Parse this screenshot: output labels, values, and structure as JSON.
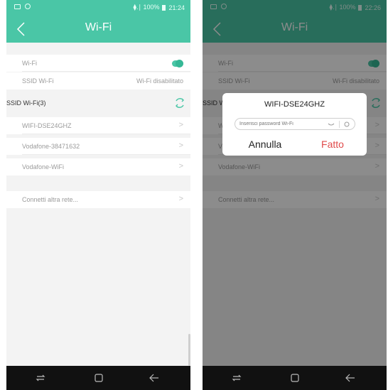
{
  "phones": [
    {
      "status_time": "21:24",
      "status_signal": "⧫.∣ 100%",
      "title": "Wi-Fi",
      "wifi_label": "Wi-Fi",
      "wifi_enabled": true,
      "ssid_label": "SSID Wi-Fi",
      "ssid_value": "Wi-Fi disabilitato",
      "networks_header": "SSID Wi-Fi(3)",
      "networks": [
        "WIFI-DSE24GHZ",
        "Vodafone-38471632",
        "Vodafone-WiFi"
      ],
      "other_network": "Connetti altra rete..."
    },
    {
      "status_time": "22:26",
      "status_signal": "⧫.∣ 100%",
      "title": "Wi-Fi",
      "wifi_label": "Wi-Fi",
      "wifi_enabled": true,
      "ssid_label": "SSID Wi-Fi",
      "ssid_value": "Wi-Fi disabilitato",
      "networks_header": "SSID W",
      "networks": [
        "WiF",
        "Voc",
        "Vodafone-WiFi"
      ],
      "other_network": "Connetti altra rete...",
      "dialog": {
        "title": "WIFI-DSE24GHZ",
        "password_placeholder": "Inserisci password Wi-Fi",
        "cancel_label": "Annulla",
        "done_label": "Fatto"
      }
    }
  ],
  "colors": {
    "accent": "#4ac6a6",
    "done": "#e04b4b",
    "navbar": "#111111"
  },
  "icons": [
    "back-arrow-icon",
    "toggle-switch",
    "refresh-icon",
    "chevron-right-icon",
    "recents-icon",
    "home-icon",
    "nav-back-icon",
    "eye-icon",
    "clear-icon"
  ]
}
